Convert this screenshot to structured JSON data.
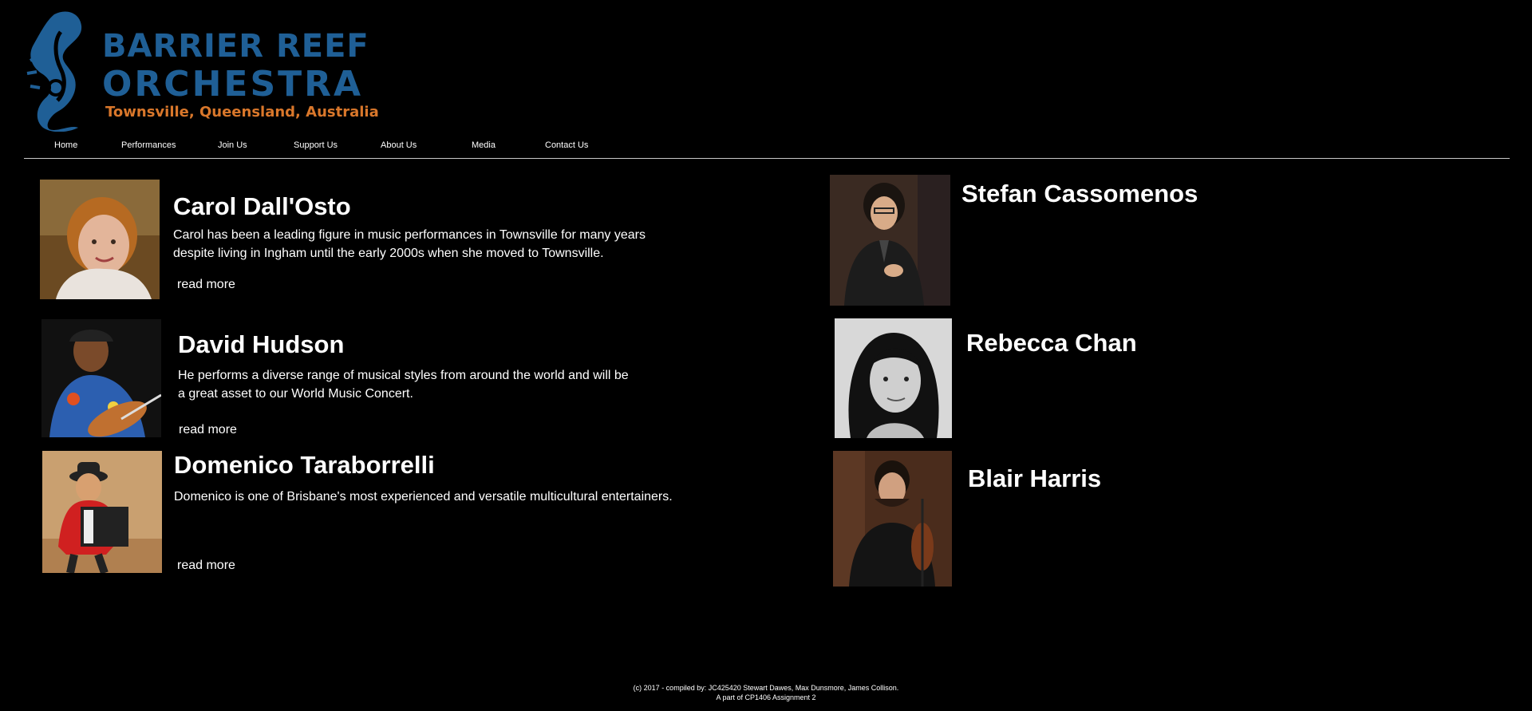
{
  "logo": {
    "line1": "BARRIER REEF",
    "line2": "ORCHESTRA",
    "tagline": "Townsville, Queensland, Australia",
    "brand_blue": "#1f5f96",
    "brand_orange": "#d9772b",
    "icon": "treble-clef-seahorse-icon"
  },
  "nav": [
    {
      "label": "Home"
    },
    {
      "label": "Performances"
    },
    {
      "label": "Join Us"
    },
    {
      "label": "Support Us"
    },
    {
      "label": "About Us"
    },
    {
      "label": "Media"
    },
    {
      "label": "Contact Us"
    }
  ],
  "musicians_left": [
    {
      "name": "Carol Dall'Osto",
      "bio": "Carol has been a leading figure in music performances in Townsville for many years despite living in Ingham until the early 2000s when she moved to Townsville.",
      "read_more": "read more"
    },
    {
      "name": "David Hudson",
      "bio": "He performs a diverse range of musical styles from around the world and will be a great asset to our World Music Concert.",
      "read_more": "read more"
    },
    {
      "name": "Domenico Taraborrelli",
      "bio": "Domenico is one of Brisbane's most experienced and versatile multicultural entertainers.",
      "read_more": "read more"
    }
  ],
  "musicians_right": [
    {
      "name": "Stefan Cassomenos"
    },
    {
      "name": "Rebecca Chan"
    },
    {
      "name": "Blair Harris"
    }
  ],
  "footer": {
    "line1": "(c) 2017 - compiled by: JC425420 Stewart Dawes, Max Dunsmore, James Collison.",
    "line2": "A part of CP1406 Assignment 2"
  }
}
